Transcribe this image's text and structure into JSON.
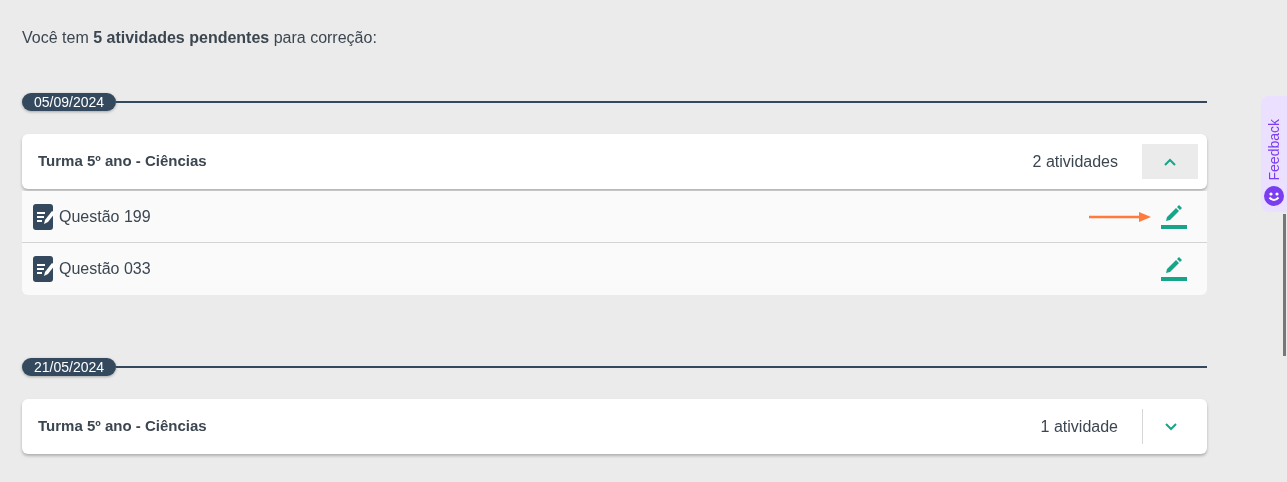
{
  "intro": "Você tem **5 atividades pendentes** para correção:",
  "groups": [
    {
      "date": "05/09/2024",
      "class_name": "Turma 5º ano - Ciências",
      "count": "2 atividades",
      "expanded": true,
      "items": [
        {
          "title": "Questão 199",
          "highlighted": true
        },
        {
          "title": "Questão 033",
          "highlighted": false
        }
      ]
    },
    {
      "date": "21/05/2024",
      "class_name": "Turma 5º ano - Ciências",
      "count": "1 atividade",
      "expanded": false
    }
  ],
  "feedback_tab": {
    "label": "Feedback"
  }
}
